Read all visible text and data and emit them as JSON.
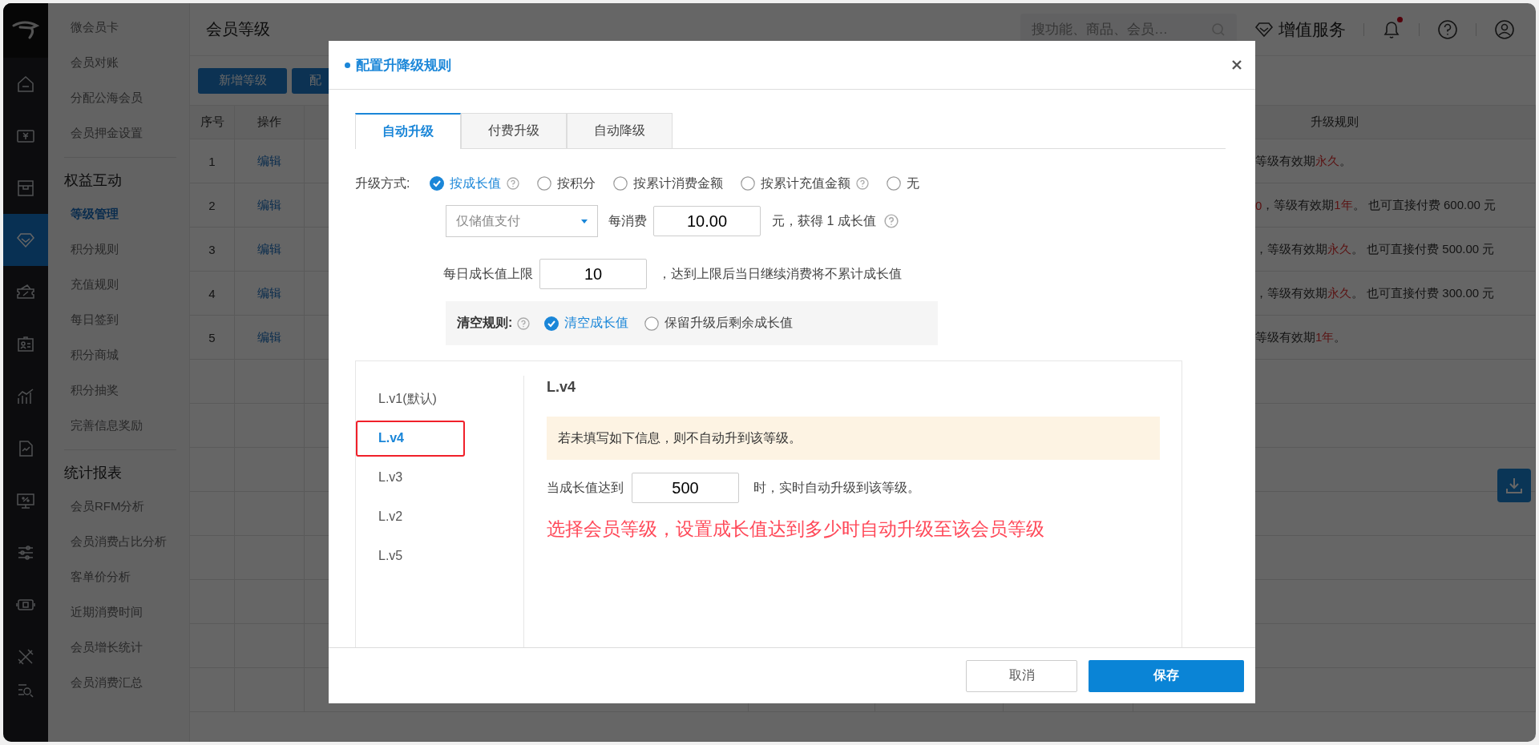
{
  "icon_rail": [
    {
      "kind": "home",
      "selected": false
    },
    {
      "kind": "money",
      "selected": false
    },
    {
      "kind": "box",
      "selected": false
    },
    {
      "kind": "diamond",
      "selected": true
    },
    {
      "kind": "ticket",
      "selected": false
    },
    {
      "kind": "card",
      "selected": false
    },
    {
      "kind": "chart",
      "selected": false
    },
    {
      "kind": "report",
      "selected": false
    },
    {
      "kind": "monitor",
      "selected": false
    },
    {
      "kind": "sliders",
      "selected": false
    },
    {
      "kind": "register",
      "selected": false
    },
    {
      "kind": "tools",
      "selected": false
    },
    {
      "kind": "searchlist",
      "selected": false
    }
  ],
  "sidebar": {
    "groups": [
      {
        "items": [
          {
            "label": "微会员卡",
            "selected": false
          },
          {
            "label": "会员对账",
            "selected": false
          },
          {
            "label": "分配公海会员",
            "selected": false
          },
          {
            "label": "会员押金设置",
            "selected": false
          }
        ]
      },
      {
        "heading": "权益互动",
        "items": [
          {
            "label": "等级管理",
            "selected": true
          },
          {
            "label": "积分规则",
            "selected": false
          },
          {
            "label": "充值规则",
            "selected": false
          },
          {
            "label": "每日签到",
            "selected": false
          },
          {
            "label": "积分商城",
            "selected": false
          },
          {
            "label": "积分抽奖",
            "selected": false
          },
          {
            "label": "完善信息奖励",
            "selected": false
          }
        ]
      },
      {
        "heading": "统计报表",
        "items": [
          {
            "label": "会员RFM分析",
            "selected": false
          },
          {
            "label": "会员消费占比分析",
            "selected": false
          },
          {
            "label": "客单价分析",
            "selected": false
          },
          {
            "label": "近期消费时间",
            "selected": false
          },
          {
            "label": "会员增长统计",
            "selected": false
          },
          {
            "label": "会员消费汇总",
            "selected": false
          }
        ]
      }
    ]
  },
  "page_title": "会员等级",
  "search": {
    "placeholder": "搜功能、商品、会员…"
  },
  "value_service": "增值服务",
  "notifications": {
    "unread": true
  },
  "toolbar_buttons": [
    "新增等级",
    "配"
  ],
  "table": {
    "columns": [
      "序号",
      "操作",
      "升级规则"
    ],
    "rows": [
      {
        "index": "1",
        "action": "编辑",
        "rule": [
          {
            "text": "等级有效期 ",
            "highlight": false
          },
          {
            "text": "永久",
            "highlight": true
          },
          {
            "text": "。",
            "highlight": false
          }
        ]
      },
      {
        "index": "2",
        "action": "编辑",
        "rule": [
          {
            "text": "0",
            "highlight": true
          },
          {
            "text": "，等级有效期 ",
            "highlight": false
          },
          {
            "text": "1年",
            "highlight": true
          },
          {
            "text": "。 也可直接付费 600.00 元",
            "highlight": false
          }
        ]
      },
      {
        "index": "3",
        "action": "编辑",
        "rule": [
          {
            "text": "，等级有效期 ",
            "highlight": false
          },
          {
            "text": "永久",
            "highlight": true
          },
          {
            "text": "。 也可直接付费 500.00 元",
            "highlight": false
          }
        ]
      },
      {
        "index": "4",
        "action": "编辑",
        "rule": [
          {
            "text": "，等级有效期 ",
            "highlight": false
          },
          {
            "text": "永久",
            "highlight": true
          },
          {
            "text": "。 也可直接付费 300.00 元",
            "highlight": false
          }
        ]
      },
      {
        "index": "5",
        "action": "编辑",
        "rule": [
          {
            "text": "等级有效期 ",
            "highlight": false
          },
          {
            "text": "1年",
            "highlight": true
          },
          {
            "text": "。",
            "highlight": false
          }
        ]
      }
    ]
  },
  "modal": {
    "title": "配置升降级规则",
    "tabs": [
      {
        "label": "自动升级",
        "selected": true
      },
      {
        "label": "付费升级",
        "selected": false
      },
      {
        "label": "自动降级",
        "selected": false
      }
    ],
    "method_label": "升级方式:",
    "methods": [
      {
        "label": "按成长值",
        "selected": true,
        "help": true
      },
      {
        "label": "按积分",
        "selected": false,
        "help": false
      },
      {
        "label": "按累计消费金额",
        "selected": false,
        "help": false
      },
      {
        "label": "按累计充值金额",
        "selected": false,
        "help": true
      },
      {
        "label": "无",
        "selected": false,
        "help": false
      }
    ],
    "payment_select": {
      "value": "仅储值支付"
    },
    "spend_label": "每消费",
    "spend_value": "10.00",
    "spend_suffix": "元，获得 1 成长值",
    "daily_label": "每日成长值上限",
    "daily_value": "10",
    "daily_suffix": "，达到上限后当日继续消费将不累计成长值",
    "clear_label": "清空规则:",
    "clear_options": [
      {
        "label": "清空成长值",
        "selected": true
      },
      {
        "label": "保留升级后剩余成长值",
        "selected": false
      }
    ],
    "levels": [
      {
        "label": "L.v1(默认)",
        "selected": false,
        "highlighted": false
      },
      {
        "label": "L.v4",
        "selected": true,
        "highlighted": true
      },
      {
        "label": "L.v3",
        "selected": false,
        "highlighted": false
      },
      {
        "label": "L.v2",
        "selected": false,
        "highlighted": false
      },
      {
        "label": "L.v5",
        "selected": false,
        "highlighted": false
      }
    ],
    "detail": {
      "title": "L.v4",
      "notice": "若未填写如下信息，则不自动升到该等级。",
      "threshold_label": "当成长值达到",
      "threshold_value": "500",
      "threshold_suffix": "时，实时自动升级到该等级。",
      "note": "选择会员等级，设置成长值达到多少时自动升级至该会员等级"
    },
    "buttons": [
      {
        "label": "取消",
        "kind": "secondary"
      },
      {
        "label": "保存",
        "kind": "primary"
      }
    ]
  }
}
